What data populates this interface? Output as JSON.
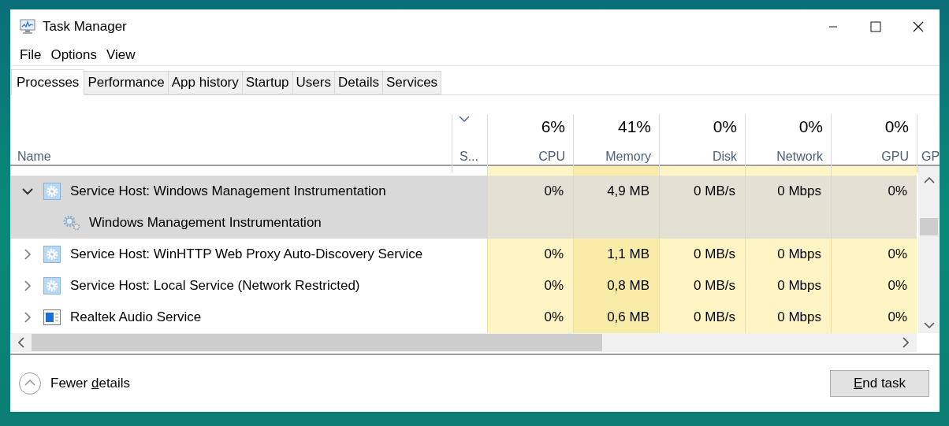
{
  "window": {
    "title": "Task Manager"
  },
  "menu": [
    "File",
    "Options",
    "View"
  ],
  "tabs": [
    {
      "label": "Processes",
      "selected": true
    },
    {
      "label": "Performance",
      "selected": false
    },
    {
      "label": "App history",
      "selected": false
    },
    {
      "label": "Startup",
      "selected": false
    },
    {
      "label": "Users",
      "selected": false
    },
    {
      "label": "Details",
      "selected": false
    },
    {
      "label": "Services",
      "selected": false
    }
  ],
  "columns": [
    {
      "kind": "name",
      "label": "Name",
      "sorted": false
    },
    {
      "kind": "status",
      "label": "S...",
      "sorted": true
    },
    {
      "kind": "metric",
      "usage": "6%",
      "label": "CPU",
      "sorted": false
    },
    {
      "kind": "metric",
      "usage": "41%",
      "label": "Memory",
      "sorted": false
    },
    {
      "kind": "metric",
      "usage": "0%",
      "label": "Disk",
      "sorted": false
    },
    {
      "kind": "metric",
      "usage": "0%",
      "label": "Network",
      "sorted": false
    },
    {
      "kind": "metric",
      "usage": "0%",
      "label": "GPU",
      "sorted": false
    },
    {
      "kind": "cut",
      "label": "GP",
      "sorted": false
    }
  ],
  "rows": [
    {
      "name": "Service Host: Windows Management Instrumentation",
      "kind": "host",
      "expanded": true,
      "selected": true,
      "values": [
        "0%",
        "4,9 MB",
        "0 MB/s",
        "0 Mbps",
        "0%"
      ],
      "children": [
        {
          "name": "Windows Management Instrumentation",
          "kind": "service",
          "selected": true
        }
      ]
    },
    {
      "name": "Service Host: WinHTTP Web Proxy Auto-Discovery Service",
      "kind": "host",
      "expanded": false,
      "selected": false,
      "values": [
        "0%",
        "1,1 MB",
        "0 MB/s",
        "0 Mbps",
        "0%"
      ]
    },
    {
      "name": "Service Host: Local Service (Network Restricted)",
      "kind": "host",
      "expanded": false,
      "selected": false,
      "values": [
        "0%",
        "0,8 MB",
        "0 MB/s",
        "0 Mbps",
        "0%"
      ]
    },
    {
      "name": "Realtek Audio Service",
      "kind": "app",
      "expanded": false,
      "selected": false,
      "values": [
        "0%",
        "0,6 MB",
        "0 MB/s",
        "0 Mbps",
        "0%"
      ]
    }
  ],
  "footer": {
    "details_button": {
      "label": "Fewer details"
    },
    "end_task_button": {
      "label": "End task"
    }
  }
}
